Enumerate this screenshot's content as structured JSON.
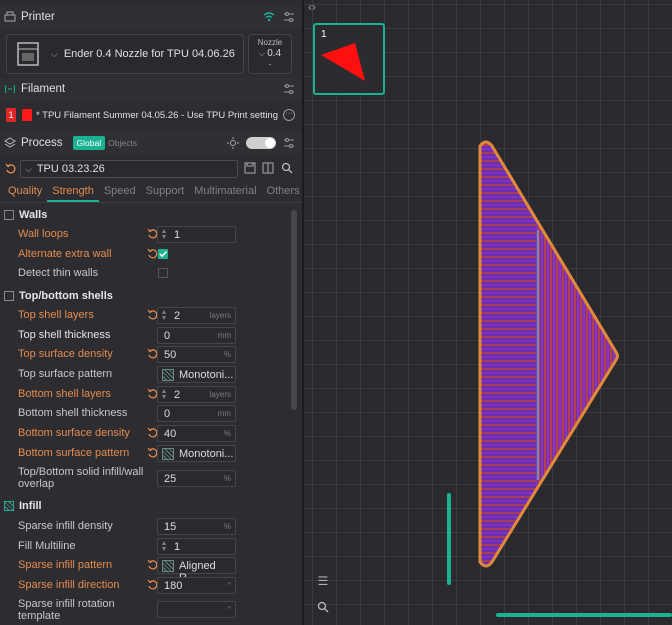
{
  "printer": {
    "title": "Printer",
    "preset": "Ender 0.4 Nozzle for TPU 04.06.26",
    "nozzle_label": "Nozzle",
    "nozzle_value": "0.4",
    "nozzle_dash": "-"
  },
  "filament": {
    "title": "Filament",
    "index": "1",
    "color": "#ff1a1a",
    "name": "* TPU Filament Summer 04.05.26 - Use TPU Print setting"
  },
  "process": {
    "title": "Process",
    "toggle_global": "Global",
    "toggle_objects": "Objects",
    "preset": "TPU 03.23.26",
    "tabs": [
      "Quality",
      "Strength",
      "Speed",
      "Support",
      "Multimaterial",
      "Others"
    ],
    "active_tab": "Strength"
  },
  "groups": {
    "walls": "Walls",
    "topbottom": "Top/bottom shells",
    "infill": "Infill"
  },
  "settings": {
    "wall_loops": {
      "label": "Wall loops",
      "value": "1"
    },
    "alternate_extra_wall": {
      "label": "Alternate extra wall"
    },
    "detect_thin_walls": {
      "label": "Detect thin walls"
    },
    "top_shell_layers": {
      "label": "Top shell layers",
      "value": "2",
      "unit": "layers"
    },
    "top_shell_thickness": {
      "label": "Top shell thickness",
      "value": "0",
      "unit": "mm"
    },
    "top_surface_density": {
      "label": "Top surface density",
      "value": "50",
      "unit": "%"
    },
    "top_surface_pattern": {
      "label": "Top surface pattern",
      "value": "Monotoni..."
    },
    "bottom_shell_layers": {
      "label": "Bottom shell layers",
      "value": "2",
      "unit": "layers"
    },
    "bottom_shell_thickness": {
      "label": "Bottom shell thickness",
      "value": "0",
      "unit": "mm"
    },
    "bottom_surface_density": {
      "label": "Bottom surface density",
      "value": "40",
      "unit": "%"
    },
    "bottom_surface_pattern": {
      "label": "Bottom surface pattern",
      "value": "Monotoni..."
    },
    "solid_infill_overlap": {
      "label": "Top/Bottom solid infill/wall overlap",
      "value": "25",
      "unit": "%"
    },
    "sparse_infill_density": {
      "label": "Sparse infill density",
      "value": "15",
      "unit": "%"
    },
    "fill_multiline": {
      "label": "Fill Multiline",
      "value": "1"
    },
    "sparse_infill_pattern": {
      "label": "Sparse infill pattern",
      "value": "Aligned R..."
    },
    "sparse_infill_direction": {
      "label": "Sparse infill direction",
      "value": "180",
      "unit": "°"
    },
    "sparse_infill_rotation": {
      "label": "Sparse infill rotation template",
      "value": "",
      "unit": "°"
    }
  },
  "viewport": {
    "plate_number": "1",
    "collapse": "‹›"
  },
  "colors": {
    "accent": "#19b394",
    "modified": "#e58b4e",
    "model_fill": "#6c2fb0",
    "model_outline": "#e08a3c",
    "infill_lines": "#d0442a"
  }
}
